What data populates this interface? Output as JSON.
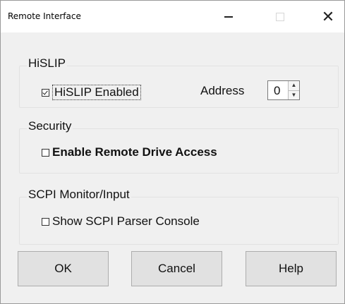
{
  "window": {
    "title": "Remote Interface",
    "minimize_glyph": "—",
    "close_glyph": "✕"
  },
  "hislip": {
    "group_label": "HiSLIP",
    "enabled_label": "HiSLIP Enabled",
    "enabled_checked": true,
    "address_label": "Address",
    "address_value": "0"
  },
  "security": {
    "group_label": "Security",
    "remote_drive_label": "Enable Remote Drive Access",
    "remote_drive_checked": false
  },
  "scpi": {
    "group_label": "SCPI Monitor/Input",
    "console_label": "Show SCPI Parser Console",
    "console_checked": false
  },
  "buttons": {
    "ok": "OK",
    "cancel": "Cancel",
    "help": "Help"
  },
  "icons": {
    "minimize": "minimize-icon",
    "maximize": "maximize-icon",
    "close": "close-icon",
    "spin_up": "chevron-up-icon",
    "spin_down": "chevron-down-icon"
  }
}
